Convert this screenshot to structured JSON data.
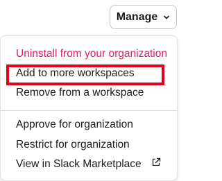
{
  "manage_button": {
    "label": "Manage",
    "icon": "chevron-down-icon"
  },
  "menu": {
    "items": [
      {
        "label": "Uninstall from your organization",
        "color": "#e01e5a"
      },
      {
        "label": "Add to more workspaces"
      },
      {
        "label": "Remove from a workspace"
      },
      {
        "label": "Approve for organization"
      },
      {
        "label": "Restrict for organization"
      },
      {
        "label": "View in Slack Marketplace",
        "icon": "external-link-icon"
      }
    ]
  },
  "highlight": {
    "color": "#e3001b",
    "target": "Add to more workspaces"
  }
}
